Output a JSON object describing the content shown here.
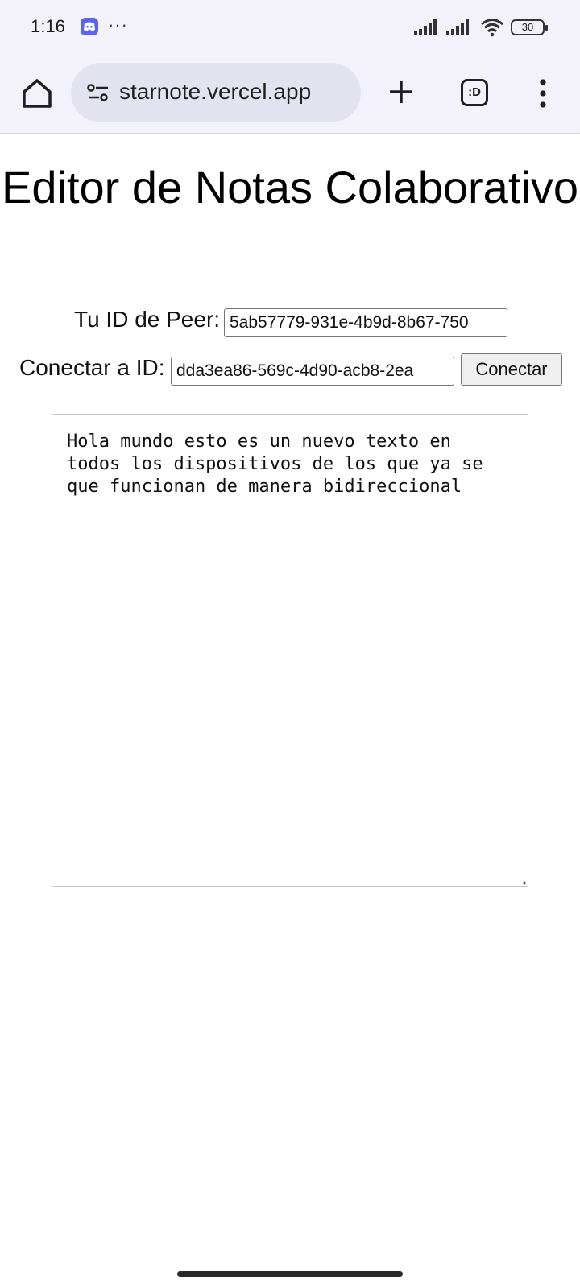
{
  "status_bar": {
    "time": "1:16",
    "notification_icons": [
      "discord-icon"
    ],
    "more_indicator": "···",
    "battery_level": "30"
  },
  "browser": {
    "url": "starnote.vercel.app",
    "tabs_label": ":D",
    "toolbar_icons": [
      "home-icon",
      "site-settings-icon",
      "plus-icon",
      "tabs-icon",
      "kebab-menu-icon"
    ]
  },
  "page": {
    "title": "Editor de Notas Colaborativo",
    "peer_label": "Tu ID de Peer:",
    "peer_id": "5ab57779-931e-4b9d-8b67-750",
    "connect_label": "Conectar a ID:",
    "connect_id": "dda3ea86-569c-4d90-acb8-2ea",
    "connect_button": "Conectar",
    "note_text": "Hola mundo esto es un nuevo texto en todos los dispositivos de los que ya se que funcionan de manera bidireccional"
  },
  "colors": {
    "chrome_background": "#f3f2fa",
    "url_pill": "#e3e3f0",
    "discord_brand": "#5865f2",
    "page_background": "#ffffff"
  }
}
